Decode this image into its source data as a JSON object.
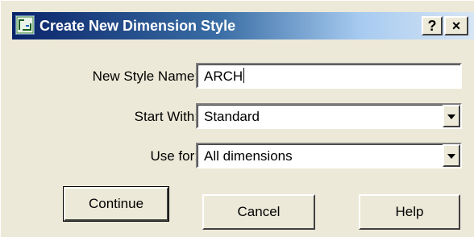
{
  "dialog": {
    "title": "Create New Dimension Style",
    "help_caption": "?",
    "close_caption": "×"
  },
  "form": {
    "new_style_name_label": "New Style Name:",
    "new_style_name_value": "ARCH",
    "start_with_label": "Start With:",
    "start_with_value": "Standard",
    "use_for_label": "Use for:",
    "use_for_value": "All dimensions"
  },
  "buttons": {
    "continue_label": "Continue",
    "cancel_label": "Cancel",
    "help_label": "Help"
  },
  "icons": {
    "app_icon": "dimension-style-icon",
    "dropdown": "chevron-down-icon"
  }
}
